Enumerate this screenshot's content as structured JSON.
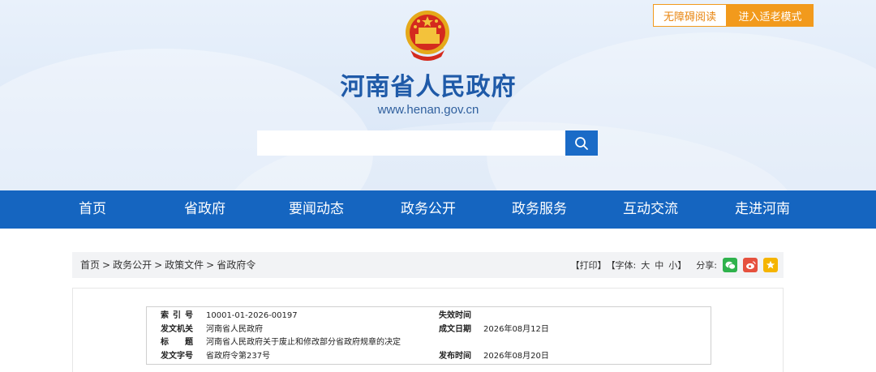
{
  "header": {
    "accessible_reading": "无障碍阅读",
    "elder_mode": "进入适老模式",
    "site_title": "河南省人民政府",
    "site_url": "www.henan.gov.cn",
    "search_placeholder": "",
    "emblem_icon": "national-emblem-icon",
    "search_icon": "search-icon"
  },
  "nav": {
    "items": [
      "首页",
      "省政府",
      "要闻动态",
      "政务公开",
      "政务服务",
      "互动交流",
      "走进河南"
    ]
  },
  "breadcrumb": {
    "items": [
      "首页",
      "政务公开",
      "政策文件",
      "省政府令"
    ],
    "separator": ">"
  },
  "tools": {
    "print": "【打印】",
    "font_label": "【字体:",
    "font_large": "大",
    "font_medium": "中",
    "font_small": "小",
    "font_close": "】",
    "share_label": "分享:",
    "share_icons": [
      "wechat-icon",
      "weibo-icon",
      "favorite-icon"
    ]
  },
  "info": {
    "index_label": "索引号",
    "index_value": "10001-01-2026-00197",
    "issuer_label": "发文机关",
    "issuer_value": "河南省人民政府",
    "title_label": "标题",
    "title_value": "河南省人民政府关于废止和修改部分省政府规章的决定",
    "docno_label": "发文字号",
    "docno_value": "省政府令第237号",
    "expire_label": "失效时间",
    "expire_value": "",
    "created_label": "成文日期",
    "created_value": "2026年08月12日",
    "published_label": "发布时间",
    "published_value": "2026年08月20日"
  },
  "colors": {
    "brand_blue": "#1565c0",
    "accent_orange": "#f29a1c",
    "title_blue": "#1f5aa8"
  }
}
